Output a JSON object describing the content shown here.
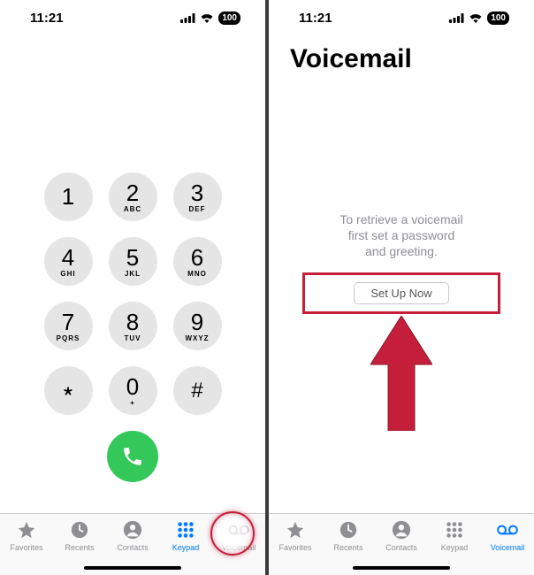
{
  "status": {
    "time": "11:21",
    "battery": "100"
  },
  "keypad": {
    "keys": [
      {
        "digit": "1",
        "letters": ""
      },
      {
        "digit": "2",
        "letters": "ABC"
      },
      {
        "digit": "3",
        "letters": "DEF"
      },
      {
        "digit": "4",
        "letters": "GHI"
      },
      {
        "digit": "5",
        "letters": "JKL"
      },
      {
        "digit": "6",
        "letters": "MNO"
      },
      {
        "digit": "7",
        "letters": "PQRS"
      },
      {
        "digit": "8",
        "letters": "TUV"
      },
      {
        "digit": "9",
        "letters": "WXYZ"
      },
      {
        "digit": "﹡",
        "letters": ""
      },
      {
        "digit": "0",
        "letters": "+"
      },
      {
        "digit": "#",
        "letters": ""
      }
    ]
  },
  "tabs": {
    "favorites": "Favorites",
    "recents": "Recents",
    "contacts": "Contacts",
    "keypad": "Keypad",
    "voicemail": "Voicemail"
  },
  "voicemail": {
    "title": "Voicemail",
    "instructions_l1": "To retrieve a voicemail",
    "instructions_l2": "first set a password",
    "instructions_l3": "and greeting.",
    "setup_button": "Set Up Now"
  },
  "colors": {
    "accent": "#007aff",
    "call_green": "#34c759",
    "annotation_red": "#c41e3a"
  }
}
